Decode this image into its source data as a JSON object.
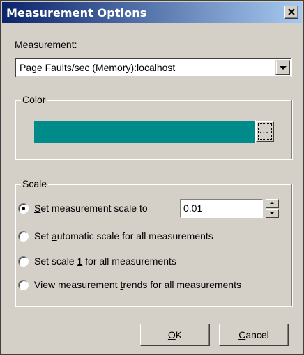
{
  "window": {
    "title": "Measurement Options",
    "close_icon": "close-icon"
  },
  "measurement": {
    "label": "Measurement:",
    "selected": "Page Faults/sec (Memory):localhost"
  },
  "color_group": {
    "legend": "Color",
    "color": "#008b8b",
    "browse_label": "..."
  },
  "scale_group": {
    "legend": "Scale",
    "options": [
      {
        "pre": "",
        "accel": "S",
        "post": "et measurement scale to",
        "checked": true
      },
      {
        "pre": "Set ",
        "accel": "a",
        "post": "utomatic scale for all measurements",
        "checked": false
      },
      {
        "pre": "Set scale ",
        "accel": "1",
        "post": " for all measurements",
        "checked": false
      },
      {
        "pre": "View measurement ",
        "accel": "t",
        "post": "rends for all measurements",
        "checked": false
      }
    ],
    "scale_value": "0.01"
  },
  "buttons": {
    "ok": {
      "accel": "O",
      "rest": "K"
    },
    "cancel": {
      "accel": "C",
      "rest": "ancel"
    }
  }
}
